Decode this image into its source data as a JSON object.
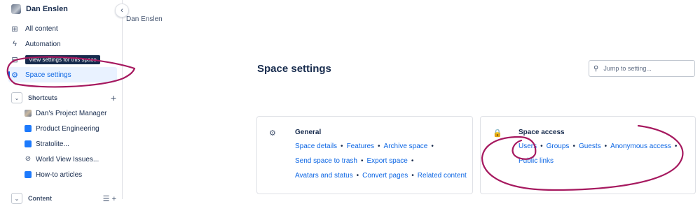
{
  "sidebar": {
    "space_name": "Dan Enslen",
    "nav": [
      {
        "label": "All content",
        "icon": "grid-icon"
      },
      {
        "label": "Automation",
        "icon": "lightning-icon"
      },
      {
        "label": "Space settings",
        "icon": "gear-icon",
        "selected": true
      }
    ],
    "tooltip": "View settings for this space",
    "shortcuts": {
      "title": "Shortcuts",
      "items": [
        {
          "label": "Dan's Project Manager",
          "icon": "person-photo-icon"
        },
        {
          "label": "Product Engineering",
          "icon": "blue-square-icon"
        },
        {
          "label": "Stratolite...",
          "icon": "blue-square-icon"
        },
        {
          "label": "World View Issues...",
          "icon": "link-icon"
        },
        {
          "label": "How-to articles",
          "icon": "blue-square-icon"
        }
      ]
    },
    "content": {
      "title": "Content"
    }
  },
  "breadcrumb": "Dan Enslen",
  "page_title": "Space settings",
  "search": {
    "placeholder": "Jump to setting..."
  },
  "cards": {
    "general": {
      "title": "General",
      "rows": [
        [
          "Space details",
          "Features",
          "Archive space"
        ],
        [
          "Send space to trash",
          "Export space"
        ],
        [
          "Avatars and status",
          "Convert pages",
          "Related content"
        ]
      ]
    },
    "access": {
      "title": "Space access",
      "rows": [
        [
          "Users",
          "Groups",
          "Guests",
          "Anonymous access"
        ],
        [
          "Public links"
        ]
      ]
    }
  },
  "separator": "•",
  "colors": {
    "link": "#0c66e4",
    "annotation": "#a6195f",
    "selected_bg": "#e9f2ff"
  }
}
